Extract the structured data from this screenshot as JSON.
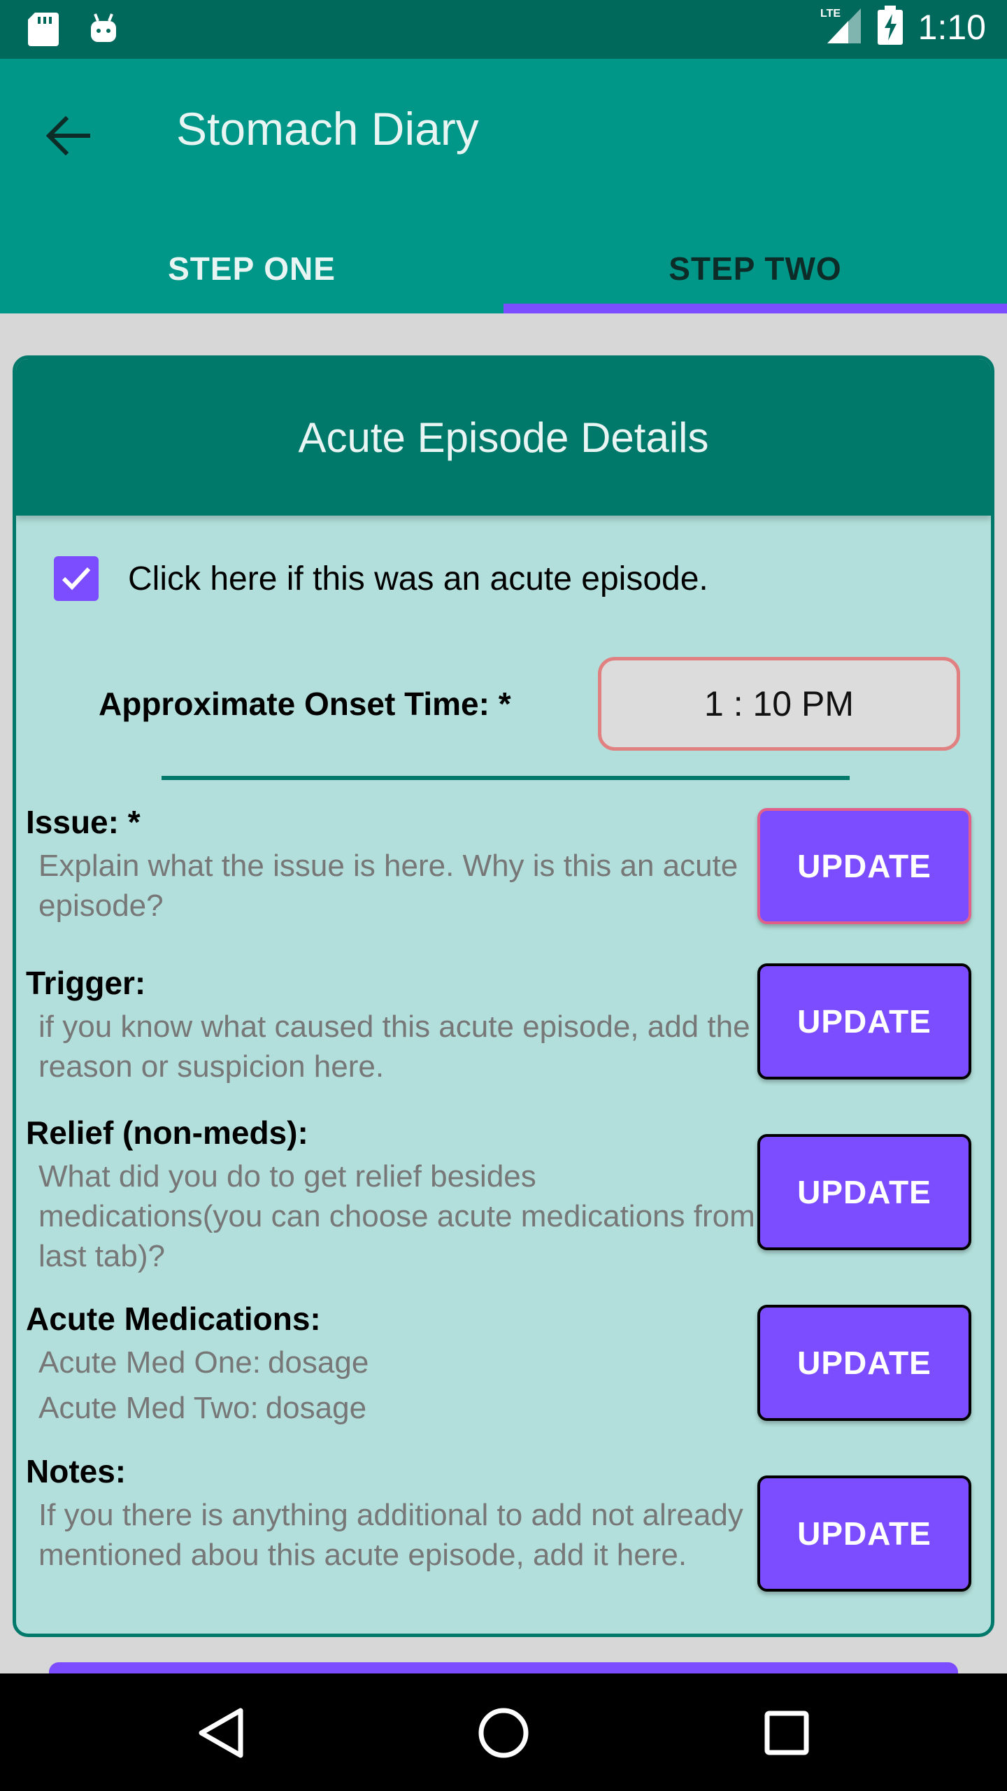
{
  "status_bar": {
    "time": "1:10",
    "network": "LTE",
    "icons": [
      "sd-card-icon",
      "android-icon",
      "lte-signal-icon",
      "battery-charging-icon"
    ]
  },
  "app_bar": {
    "title": "Stomach Diary",
    "back_icon": "arrow-back-icon"
  },
  "tabs": [
    {
      "label": "STEP ONE",
      "selected": false
    },
    {
      "label": "STEP TWO",
      "selected": true
    }
  ],
  "card": {
    "header": "Acute Episode Details",
    "acute_checkbox": {
      "label": "Click here if this was an acute episode.",
      "checked": true
    },
    "onset": {
      "label": "Approximate Onset Time: *",
      "value": "1 : 10 PM"
    },
    "sections": {
      "issue": {
        "title": "Issue: *",
        "text": "Explain what the issue is here. Why is this an acute episode?",
        "button": "UPDATE"
      },
      "trigger": {
        "title": "Trigger:",
        "text": "if you know what caused this acute episode, add the reason or suspicion here.",
        "button": "UPDATE"
      },
      "relief": {
        "title": "Relief (non-meds):",
        "text": "What did you do to get relief besides medications(you can choose acute medications from last tab)?",
        "button": "UPDATE"
      },
      "medications": {
        "title": "Acute Medications:",
        "meds": [
          {
            "name": "Acute Med One:",
            "dosage": "dosage"
          },
          {
            "name": "Acute Med Two:",
            "dosage": "dosage"
          }
        ],
        "button": "UPDATE"
      },
      "notes": {
        "title": "Notes:",
        "text": "If you there is anything additional to add not already mentioned abou this acute episode, add it here.",
        "button": "UPDATE"
      }
    }
  },
  "colors": {
    "status_bar": "#00695c",
    "app_bar": "#009688",
    "card_header": "#00796b",
    "card_body": "#b2dfdb",
    "accent": "#7c4dff",
    "focus_border": "#e0608a"
  },
  "nav_bar": {
    "icons": [
      "back-triangle-icon",
      "home-circle-icon",
      "recents-square-icon"
    ]
  }
}
